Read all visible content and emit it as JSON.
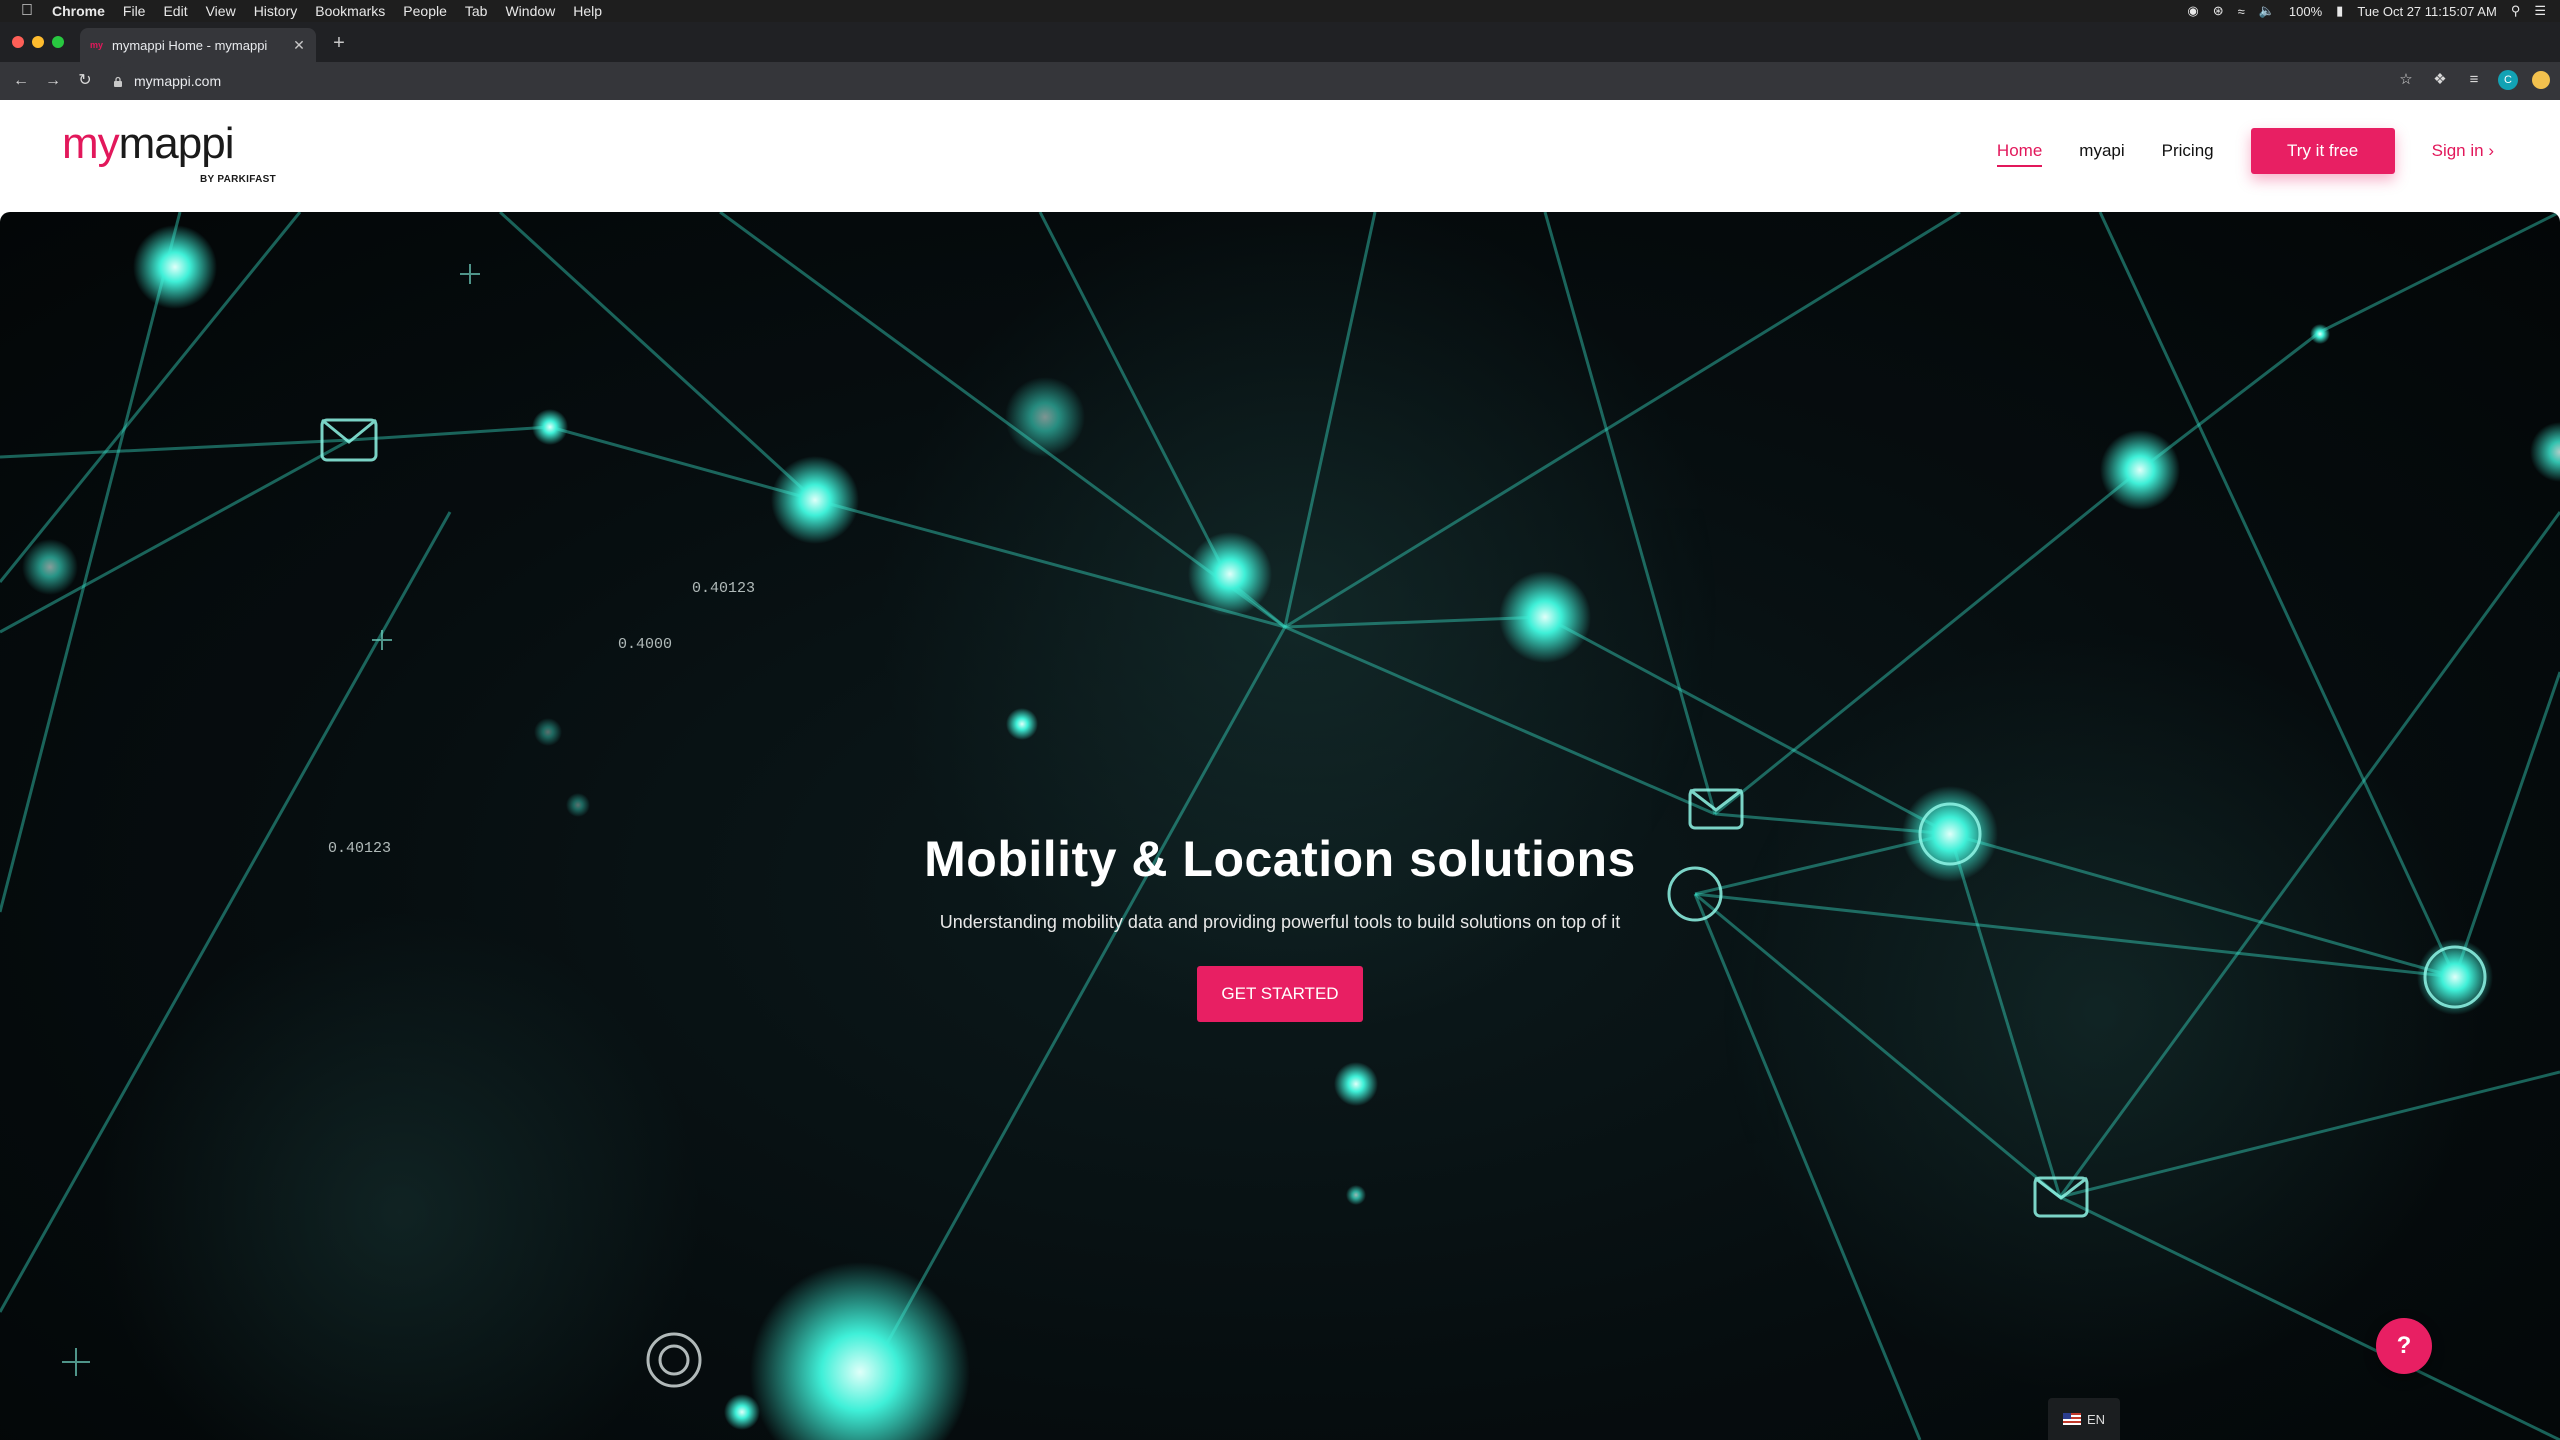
{
  "menubar": {
    "app": "Chrome",
    "items": [
      "File",
      "Edit",
      "View",
      "History",
      "Bookmarks",
      "People",
      "Tab",
      "Window",
      "Help"
    ],
    "battery": "100%",
    "datetime": "Tue Oct 27  11:15:07 AM"
  },
  "browser": {
    "tab_title": "mymappi Home - mymappi",
    "favicon_text": "my",
    "url": "mymappi.com",
    "profile_initial": "C"
  },
  "site": {
    "logo": {
      "my": "my",
      "mappi": "mappi",
      "byline": "BY PARKIFAST"
    },
    "nav": {
      "home": "Home",
      "myapi": "myapi",
      "pricing": "Pricing",
      "try_free": "Try it free",
      "sign_in": "Sign in"
    },
    "hero": {
      "title": "Mobility & Location solutions",
      "subtitle": "Understanding mobility data and providing powerful tools to build solutions on top of it",
      "cta": "GET STARTED",
      "floating_labels": [
        "0.40123",
        "0.4000",
        "0.40123"
      ]
    },
    "help_label": "?",
    "language": "EN"
  },
  "colors": {
    "brand_pink": "#e81f63",
    "hero_glow": "#3ff0d8",
    "hero_bg": "#060d0f"
  }
}
